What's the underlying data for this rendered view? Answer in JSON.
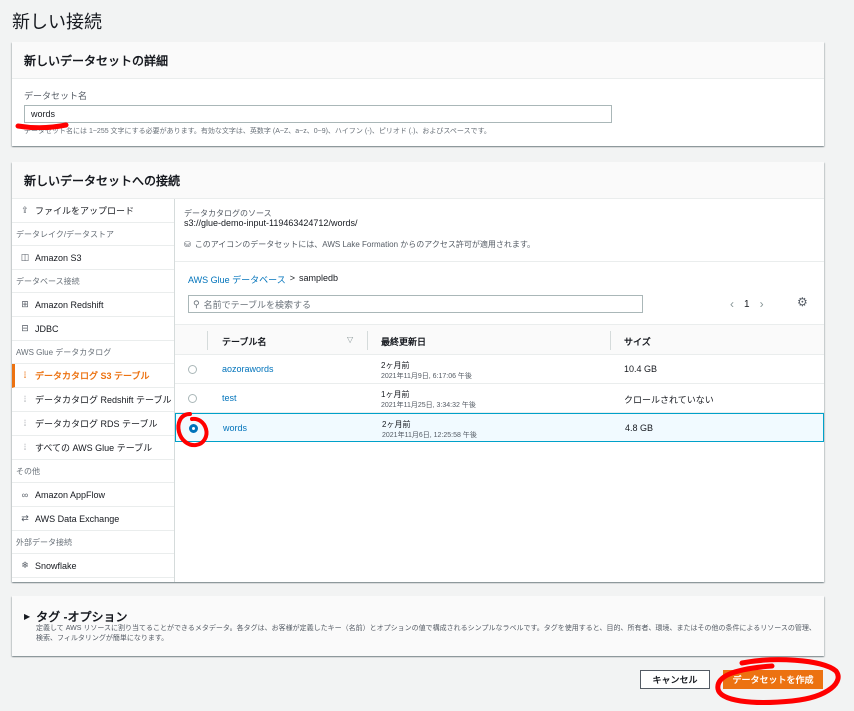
{
  "page": {
    "title": "新しい接続"
  },
  "details": {
    "header": "新しいデータセットの詳細",
    "name_label": "データセット名",
    "name_value": "words",
    "name_hint": "データセット名には 1~255 文字にする必要があります。有効な文字は、英数字 (A~Z、a~z、0~9)、ハイフン (-)、ピリオド (.)、およびスペースです。"
  },
  "connection": {
    "header": "新しいデータセットへの接続",
    "nav": [
      {
        "type": "item",
        "icon": "upload-icon",
        "glyph": "⇪",
        "label": "ファイルをアップロード"
      },
      {
        "type": "category",
        "label": "データレイク/データストア"
      },
      {
        "type": "item",
        "icon": "bucket-icon",
        "glyph": "◫",
        "label": "Amazon S3"
      },
      {
        "type": "category",
        "label": "データベース接続"
      },
      {
        "type": "item",
        "icon": "database-icon",
        "glyph": "⊞",
        "label": "Amazon Redshift"
      },
      {
        "type": "item",
        "icon": "database-icon",
        "glyph": "⊟",
        "label": "JDBC"
      },
      {
        "type": "category",
        "label": "AWS Glue データカタログ"
      },
      {
        "type": "item",
        "icon": "table-icon",
        "glyph": "⦙",
        "label": "データカタログ S3 テーブル",
        "active": true
      },
      {
        "type": "item",
        "icon": "table-icon",
        "glyph": "⦙",
        "label": "データカタログ Redshift テーブル"
      },
      {
        "type": "item",
        "icon": "table-icon",
        "glyph": "⦙",
        "label": "データカタログ RDS テーブル"
      },
      {
        "type": "item",
        "icon": "table-icon",
        "glyph": "⦙",
        "label": "すべての AWS Glue テーブル"
      },
      {
        "type": "category",
        "label": "その他"
      },
      {
        "type": "item",
        "icon": "link-icon",
        "glyph": "∞",
        "label": "Amazon AppFlow"
      },
      {
        "type": "item",
        "icon": "exchange-icon",
        "glyph": "⇄",
        "label": "AWS Data Exchange"
      },
      {
        "type": "category",
        "label": "外部データ接続"
      },
      {
        "type": "item",
        "icon": "snowflake-icon",
        "glyph": "❄",
        "label": "Snowflake"
      }
    ],
    "source_label": "データカタログのソース",
    "source_value": "s3://glue-demo-input-119463424712/words/",
    "lf_note": "このアイコンのデータセットには、AWS Lake Formation からのアクセス許可が適用されます。",
    "breadcrumb": {
      "root": "AWS Glue データベース",
      "sep": ">",
      "current": "sampledb"
    },
    "search_placeholder": "名前でテーブルを検索する",
    "pager": {
      "prev": "‹",
      "page": "1",
      "next": "›"
    },
    "table": {
      "headers": [
        "テーブル名",
        "最終更新日",
        "サイズ"
      ],
      "rows": [
        {
          "name": "aozorawords",
          "updated": "2ヶ月前",
          "updated_detail": "2021年11月9日, 6:17:06 午後",
          "size": "10.4 GB",
          "selected": false
        },
        {
          "name": "test",
          "updated": "1ヶ月前",
          "updated_detail": "2021年11月25日, 3:34:32 午後",
          "size": "クロールされていない",
          "selected": false
        },
        {
          "name": "words",
          "updated": "2ヶ月前",
          "updated_detail": "2021年11月6日, 12:25:58 午後",
          "size": "4.8 GB",
          "selected": true
        }
      ]
    }
  },
  "tags": {
    "title": "タグ -オプション",
    "desc": "定義して AWS リソースに割り当てることができるメタデータ。各タグは、お客様が定義したキー（名前）とオプションの値で構成されるシンプルなラベルです。タグを使用すると、目的、所有者、環境、またはその他の条件によるリソースの管理、検索、フィルタリングが簡単になります。"
  },
  "actions": {
    "cancel": "キャンセル",
    "create": "データセットを作成"
  },
  "colors": {
    "accent": "#ec7211",
    "link": "#0073bb",
    "annotation": "#ff0000"
  }
}
